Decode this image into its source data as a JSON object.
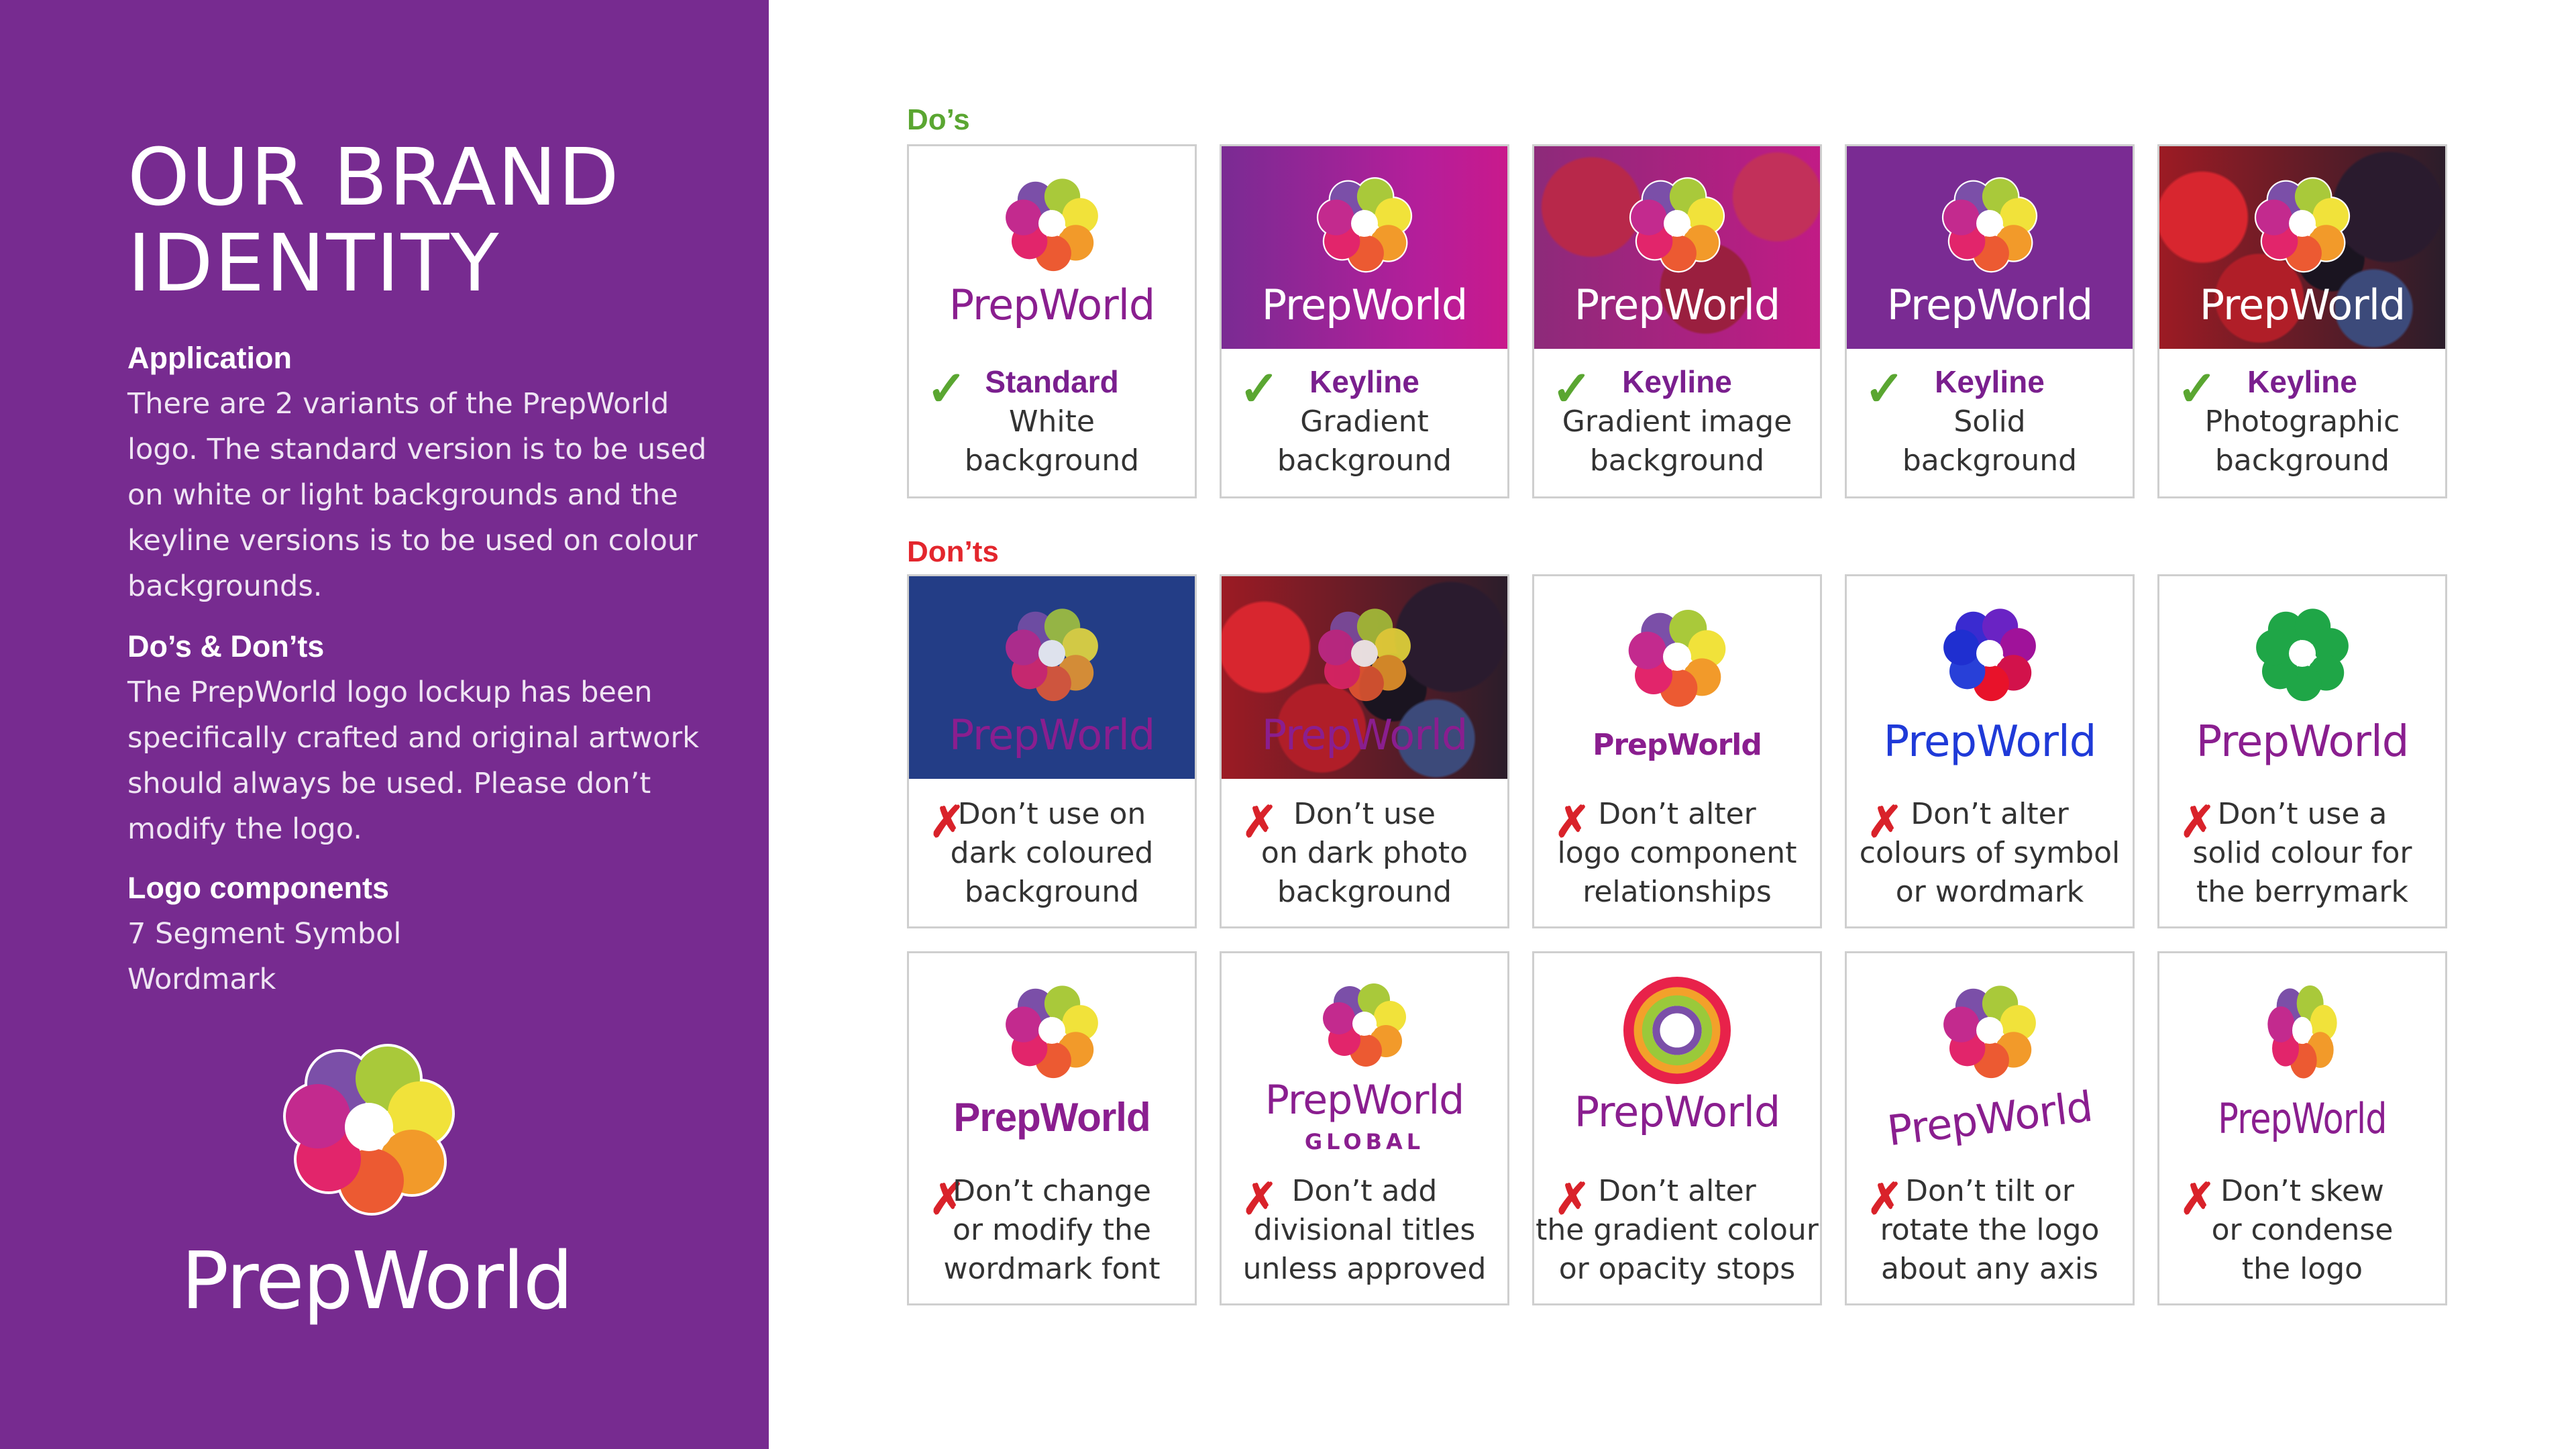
{
  "sidebar": {
    "title": "OUR BRAND IDENTITY",
    "application": {
      "heading": "Application",
      "body": "There are 2 variants of the PrepWorld logo. The standard version is to be used on white or light backgrounds and the keyline versions is to be used on colour backgrounds."
    },
    "dos_donts": {
      "heading": "Do’s & Don’ts",
      "body": "The PrepWorld logo lockup has been specifically crafted and original artwork should always be used. Please don’t modify the logo."
    },
    "components": {
      "heading": "Logo components",
      "item1": "7 Segment Symbol",
      "item2": "Wordmark"
    },
    "logo_wordmark": "PrepWorld"
  },
  "dos": {
    "label": "Do’s",
    "cards": [
      {
        "wordmark": "PrepWorld",
        "title": "Standard",
        "line1": "White",
        "line2": "background"
      },
      {
        "wordmark": "PrepWorld",
        "title": "Keyline",
        "line1": "Gradient",
        "line2": "background"
      },
      {
        "wordmark": "PrepWorld",
        "title": "Keyline",
        "line1": "Gradient image",
        "line2": "background"
      },
      {
        "wordmark": "PrepWorld",
        "title": "Keyline",
        "line1": "Solid",
        "line2": "background"
      },
      {
        "wordmark": "PrepWorld",
        "title": "Keyline",
        "line1": "Photographic",
        "line2": "background"
      }
    ]
  },
  "donts": {
    "label": "Don’ts",
    "cards": [
      {
        "wordmark": "PrepWorld",
        "line1": "Don’t use on",
        "line2": "dark coloured",
        "line3": "background"
      },
      {
        "wordmark": "PrepWorld",
        "line1": "Don’t use",
        "line2": "on dark photo",
        "line3": "background"
      },
      {
        "wordmark": "PrepWorld",
        "line1": "Don’t alter",
        "line2": "logo component",
        "line3": "relationships"
      },
      {
        "wordmark": "PrepWorld",
        "line1": "Don’t alter",
        "line2": "colours of symbol",
        "line3": "or wordmark"
      },
      {
        "wordmark": "PrepWorld",
        "line1": "Don’t use a",
        "line2": "solid colour for",
        "line3": "the berrymark"
      },
      {
        "wordmark": "PrepWorld",
        "line1": "Don’t change",
        "line2": "or modify the",
        "line3": "wordmark font"
      },
      {
        "wordmark": "PrepWorld",
        "subtitle": "GLOBAL",
        "line1": "Don’t add",
        "line2": "divisional titles",
        "line3": "unless approved"
      },
      {
        "wordmark": "PrepWorld",
        "line1": "Don’t alter",
        "line2": "the gradient colour",
        "line3": "or opacity stops"
      },
      {
        "wordmark": "PrepWorld",
        "line1": "Don’t tilt or",
        "line2": "rotate the logo",
        "line3": "about any axis"
      },
      {
        "wordmark": "PrepWorld",
        "line1": "Don’t skew",
        "line2": "or condense",
        "line3": "the logo"
      }
    ]
  },
  "marks": {
    "check": "✓",
    "cross": "✗"
  },
  "colors": {
    "brand_purple": "#772b90",
    "do_green": "#5aa631",
    "dont_red": "#e3262d"
  }
}
